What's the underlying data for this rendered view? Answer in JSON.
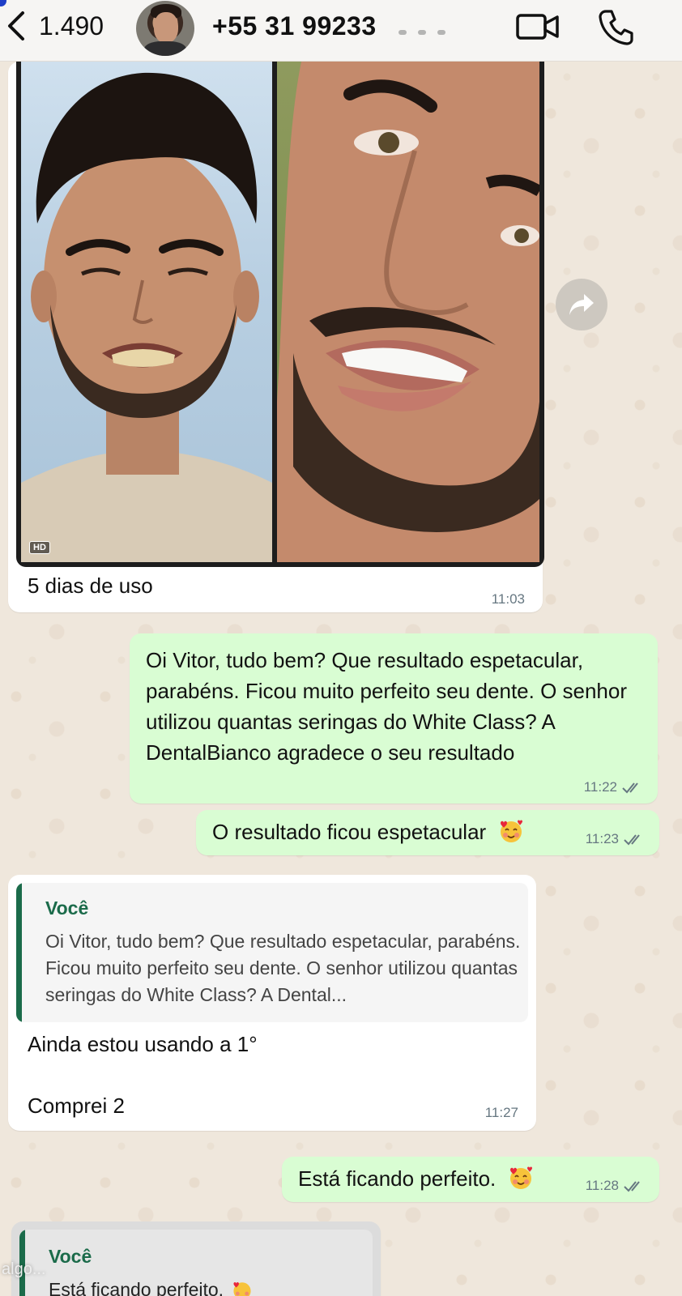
{
  "header": {
    "back_count": "1.490",
    "contact_name": "+55 31 99233",
    "avatar_alt": "contact-avatar"
  },
  "messages": {
    "image_message": {
      "caption": "5 dias de uso",
      "time": "11:03",
      "badge": "HD"
    },
    "outgoing_1": {
      "text": "Oi Vitor, tudo bem? Que resultado espetacular, parabéns. Ficou muito perfeito seu dente. O senhor utilizou quantas seringas do White Class? A DentalBianco agradece o seu resultado",
      "time": "11:22"
    },
    "outgoing_2": {
      "text": "O resultado ficou espetacular",
      "time": "11:23",
      "emoji": "smiling-face-with-hearts"
    },
    "incoming_reply": {
      "quote_author": "Você",
      "quote_text": "Oi Vitor, tudo bem? Que resultado espetacular, parabéns. Ficou muito perfeito seu dente. O senhor utilizou quantas seringas do White Class? A Dental...",
      "line1": "Ainda estou usando a 1°",
      "line2": "Comprei 2",
      "time": "11:27"
    },
    "outgoing_3": {
      "text": "Está ficando perfeito.",
      "time": "11:28",
      "emoji": "smiling-face-with-hearts"
    },
    "incoming_partial": {
      "quote_author": "Você",
      "quote_text": "Está ficando perfeito."
    }
  },
  "overlay_text": "algo...",
  "colors": {
    "outgoing_bubble": "#d9fdd3",
    "incoming_bubble": "#ffffff",
    "quote_accent": "#1b6b4a",
    "wallpaper": "#efe7dc",
    "read_ticks": "#667781"
  }
}
